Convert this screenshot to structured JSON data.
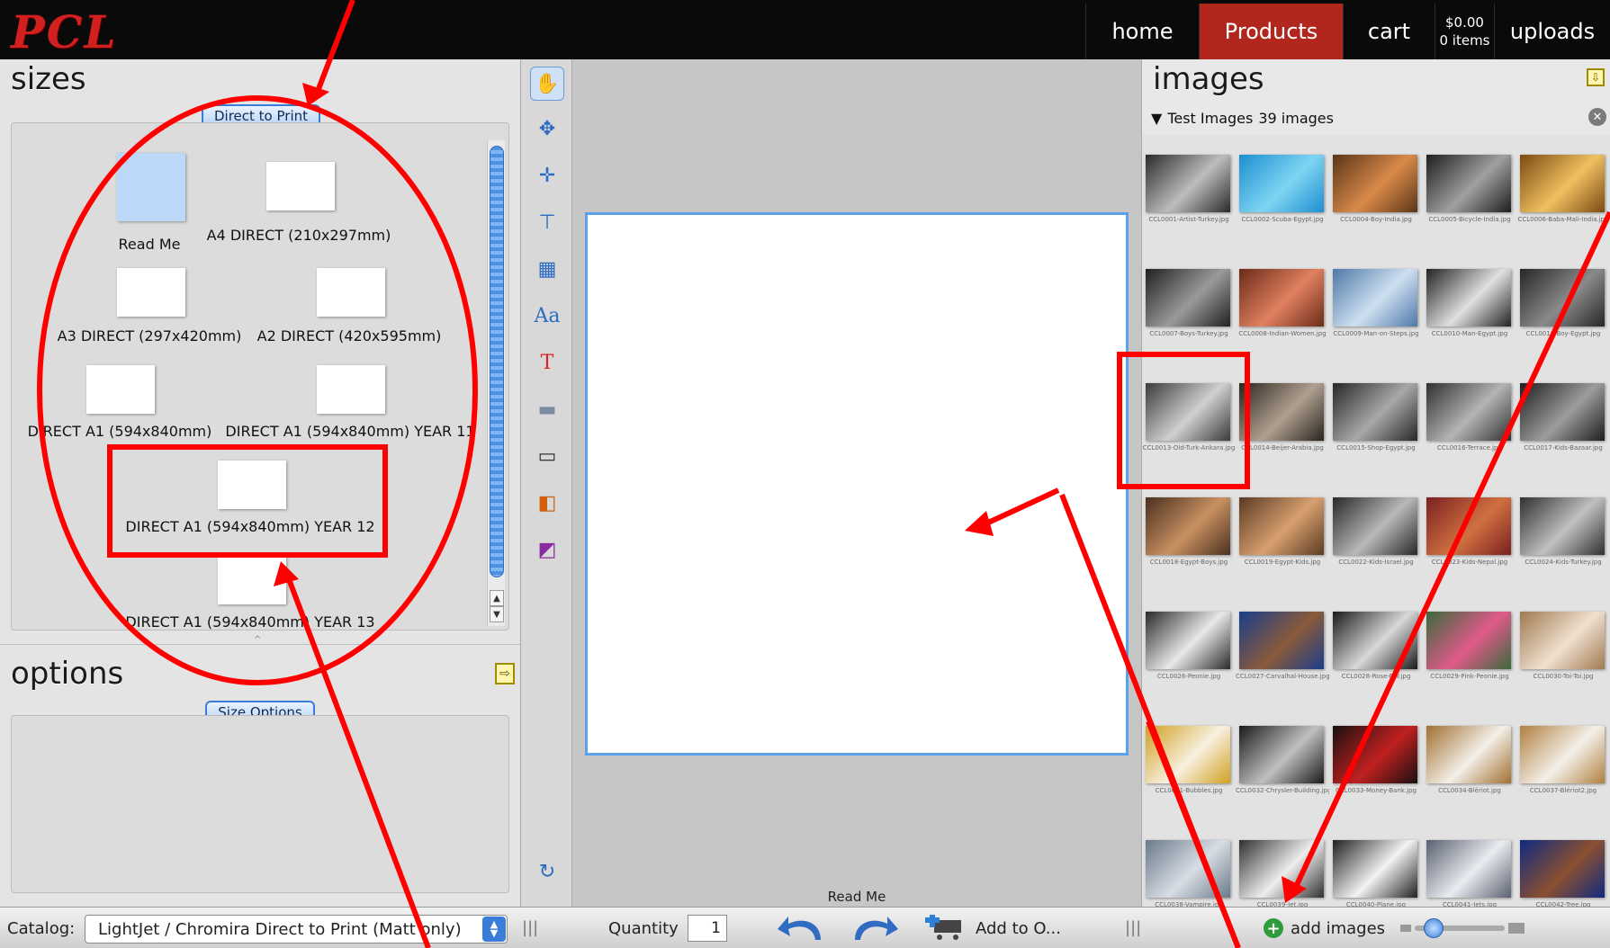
{
  "app": {
    "logo": "PCL"
  },
  "nav": {
    "home": "home",
    "products": "Products",
    "cart": "cart",
    "cart_total": "$0.00",
    "cart_items": "0 items",
    "uploads": "uploads"
  },
  "sizes": {
    "title": "sizes",
    "catalog_button": "Direct to Print",
    "items": [
      {
        "label": "Read Me"
      },
      {
        "label": "A4 DIRECT (210x297mm)"
      },
      {
        "label": "A3 DIRECT (297x420mm)"
      },
      {
        "label": "A2 DIRECT (420x595mm)"
      },
      {
        "label": "DIRECT A1 (594x840mm)"
      },
      {
        "label": "DIRECT A1 (594x840mm) YEAR 11"
      },
      {
        "label": "DIRECT A1 (594x840mm) YEAR 12"
      },
      {
        "label": "DIRECT A1 (594x840mm) YEAR 13"
      }
    ]
  },
  "options": {
    "title": "options",
    "size_options_button": "Size Options"
  },
  "canvas": {
    "caption": "Read Me"
  },
  "images": {
    "title": "images",
    "group_name": "Test Images",
    "group_count": "39 images",
    "thumbnails": [
      {
        "label": "CCL0001-Artist-Turkey.jpg",
        "c1": "#2a2a2a",
        "c2": "#bdbdbd"
      },
      {
        "label": "CCL0002-Scuba-Egypt.jpg",
        "c1": "#1c8fd0",
        "c2": "#7fd4f2"
      },
      {
        "label": "CCL0004-Boy-India.jpg",
        "c1": "#5a3416",
        "c2": "#d98a4a"
      },
      {
        "label": "CCL0005-Bicycle-India.jpg",
        "c1": "#1e1e1e",
        "c2": "#a0a0a0"
      },
      {
        "label": "CCL0006-Baba-Mali-India.jpg",
        "c1": "#7a4a12",
        "c2": "#f0c060"
      },
      {
        "label": "CCL0007-Boys-Turkey.jpg",
        "c1": "#202020",
        "c2": "#9a9a9a"
      },
      {
        "label": "CCL0008-Indian-Women.jpg",
        "c1": "#6b2a18",
        "c2": "#e08060"
      },
      {
        "label": "CCL0009-Man-on-Steps.jpg",
        "c1": "#4e78a8",
        "c2": "#cfe0f0"
      },
      {
        "label": "CCL0010-Man-Egypt.jpg",
        "c1": "#222222",
        "c2": "#e0e0e0"
      },
      {
        "label": "CCL0011-Boy-Egypt.jpg",
        "c1": "#262626",
        "c2": "#8a8a8a"
      },
      {
        "label": "CCL0013-Old-Turk-Ankara.jpg",
        "c1": "#3a3a3a",
        "c2": "#d0d0d0"
      },
      {
        "label": "CCL0014-Beijer-Arabia.jpg",
        "c1": "#2a241e",
        "c2": "#b0a090"
      },
      {
        "label": "CCL0015-Shop-Egypt.jpg",
        "c1": "#262626",
        "c2": "#a8a8a8"
      },
      {
        "label": "CCL0016-Terrace.jpg",
        "c1": "#303030",
        "c2": "#b4b4b4"
      },
      {
        "label": "CCL0017-Kids-Bazaar.jpg",
        "c1": "#1e1e1e",
        "c2": "#9c9c9c"
      },
      {
        "label": "CCL0018-Egypt-Boys.jpg",
        "c1": "#4a3020",
        "c2": "#c89060"
      },
      {
        "label": "CCL0019-Egypt-Kids.jpg",
        "c1": "#5a3a22",
        "c2": "#d8a070"
      },
      {
        "label": "CCL0022-Kids-Israel.jpg",
        "c1": "#282828",
        "c2": "#b8b8b8"
      },
      {
        "label": "CCL0023-Kids-Nepal.jpg",
        "c1": "#7a2020",
        "c2": "#d07040"
      },
      {
        "label": "CCL0024-Kids-Turkey.jpg",
        "c1": "#303030",
        "c2": "#c0c0c0"
      },
      {
        "label": "CCL0026-Peonie.jpg",
        "c1": "#2a2a2a",
        "c2": "#e8e8e8"
      },
      {
        "label": "CCL0027-Carvalhal-House.jpg",
        "c1": "#1a3e8a",
        "c2": "#8a5a3a"
      },
      {
        "label": "CCL0028-Rose-BW.jpg",
        "c1": "#1a1a1a",
        "c2": "#d8d8d8"
      },
      {
        "label": "CCL0029-Pink-Peonie.jpg",
        "c1": "#3a6a3a",
        "c2": "#e05a8a"
      },
      {
        "label": "CCL0030-Toi-Toi.jpg",
        "c1": "#a07a50",
        "c2": "#f0e0d0"
      },
      {
        "label": "CCL0031-Bubbles.jpg",
        "c1": "#d0a020",
        "c2": "#f8f0e0"
      },
      {
        "label": "CCL0032-Chrysler-Building.jpg",
        "c1": "#1a1a1a",
        "c2": "#c0c0c0"
      },
      {
        "label": "CCL0033-Money-Bank.jpg",
        "c1": "#1a1010",
        "c2": "#c02020"
      },
      {
        "label": "CCL0034-Blériot.jpg",
        "c1": "#a07030",
        "c2": "#f4efe8"
      },
      {
        "label": "CCL0037-Blériot2.jpg",
        "c1": "#b08040",
        "c2": "#f4f0ea"
      },
      {
        "label": "CCL0038-Vampire.jpg",
        "c1": "#6a7a8a",
        "c2": "#d8dde4"
      },
      {
        "label": "CCL0039-Jet.jpg",
        "c1": "#303030",
        "c2": "#eeeeee"
      },
      {
        "label": "CCL0040-Plane.jpg",
        "c1": "#202020",
        "c2": "#f2f2f2"
      },
      {
        "label": "CCL0041-Jets.jpg",
        "c1": "#5a6070",
        "c2": "#e8ecf0"
      },
      {
        "label": "CCL0042-Tree.jpg",
        "c1": "#102a80",
        "c2": "#8a5030"
      }
    ]
  },
  "bottom": {
    "catalog_label": "Catalog:",
    "catalog_value": "LightJet / Chromira Direct to Print (Matt only)",
    "quantity_label": "Quantity",
    "quantity_value": "1",
    "add_to_order": "Add to O...",
    "add_images": "add images"
  },
  "colors": {
    "accent": "#3a7dd8",
    "brand": "#d21f1f",
    "nav_active": "#b1271e",
    "annotation": "#ff0000"
  }
}
